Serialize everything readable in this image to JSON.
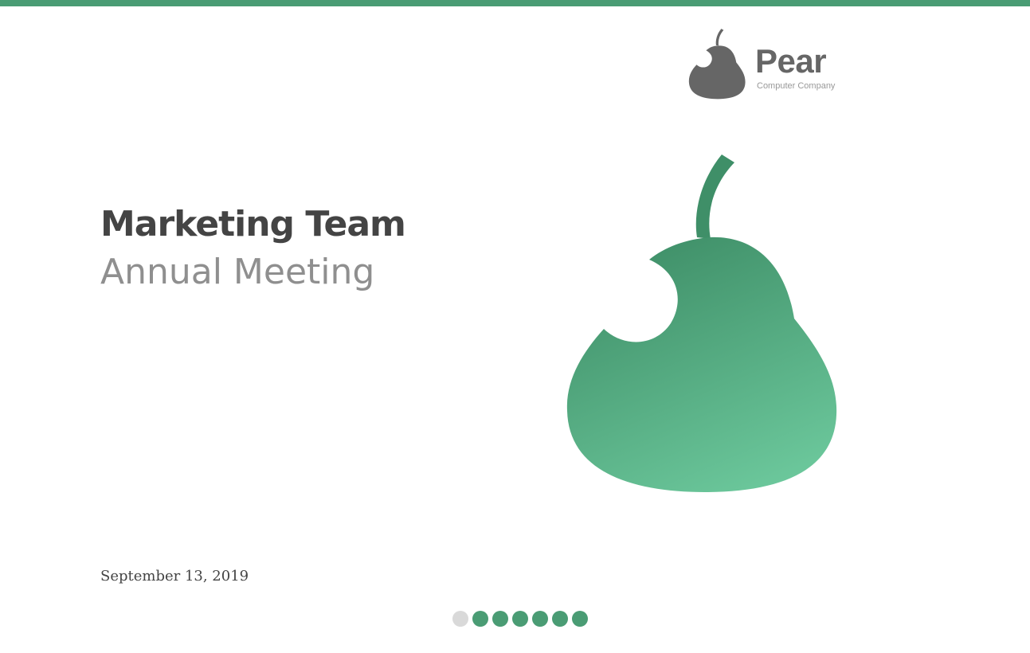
{
  "colors": {
    "accent": "#4a9c74",
    "title": "#444444",
    "subtitle": "#8f8f8f",
    "logo": "#666666",
    "dot_inactive": "#d9d9d9"
  },
  "logo": {
    "name": "Pear",
    "tagline": "Computer Company",
    "icon": "pear-bite-icon"
  },
  "slide": {
    "title": "Marketing Team",
    "subtitle": "Annual Meeting",
    "date": "September 13, 2019",
    "hero_icon": "pear-bite-icon"
  },
  "navigation": {
    "total_slides": 7,
    "current_index": 0
  }
}
